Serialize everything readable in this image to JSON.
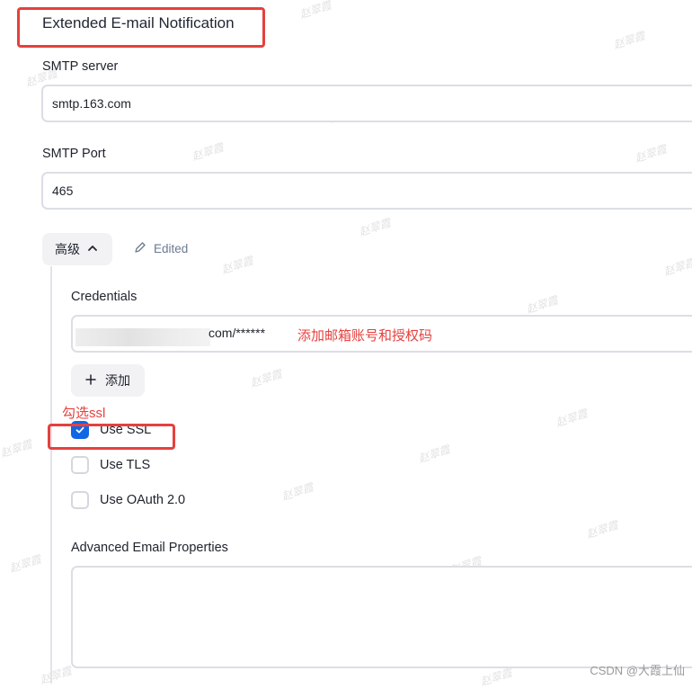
{
  "section": {
    "title": "Extended E-mail Notification"
  },
  "smtp_server": {
    "label": "SMTP server",
    "value": "smtp.163.com"
  },
  "smtp_port": {
    "label": "SMTP Port",
    "value": "465"
  },
  "advanced": {
    "toggle_label": "高级",
    "edited_label": "Edited"
  },
  "credentials": {
    "label": "Credentials",
    "value_visible": "com/******",
    "add_button_label": "添加"
  },
  "annotations": {
    "credentials_note": "添加邮箱账号和授权码",
    "ssl_note": "勾选ssl"
  },
  "options": [
    {
      "label": "Use SSL",
      "checked": true
    },
    {
      "label": "Use TLS",
      "checked": false
    },
    {
      "label": "Use OAuth 2.0",
      "checked": false
    }
  ],
  "advanced_props": {
    "label": "Advanced Email Properties",
    "value": ""
  },
  "watermark_text": "赵翠霞",
  "footer_credit": "CSDN @大霞上仙",
  "colors": {
    "annotation_red": "#e5413e",
    "checkbox_blue": "#1166e4",
    "edited_gray": "#6b7a90"
  }
}
